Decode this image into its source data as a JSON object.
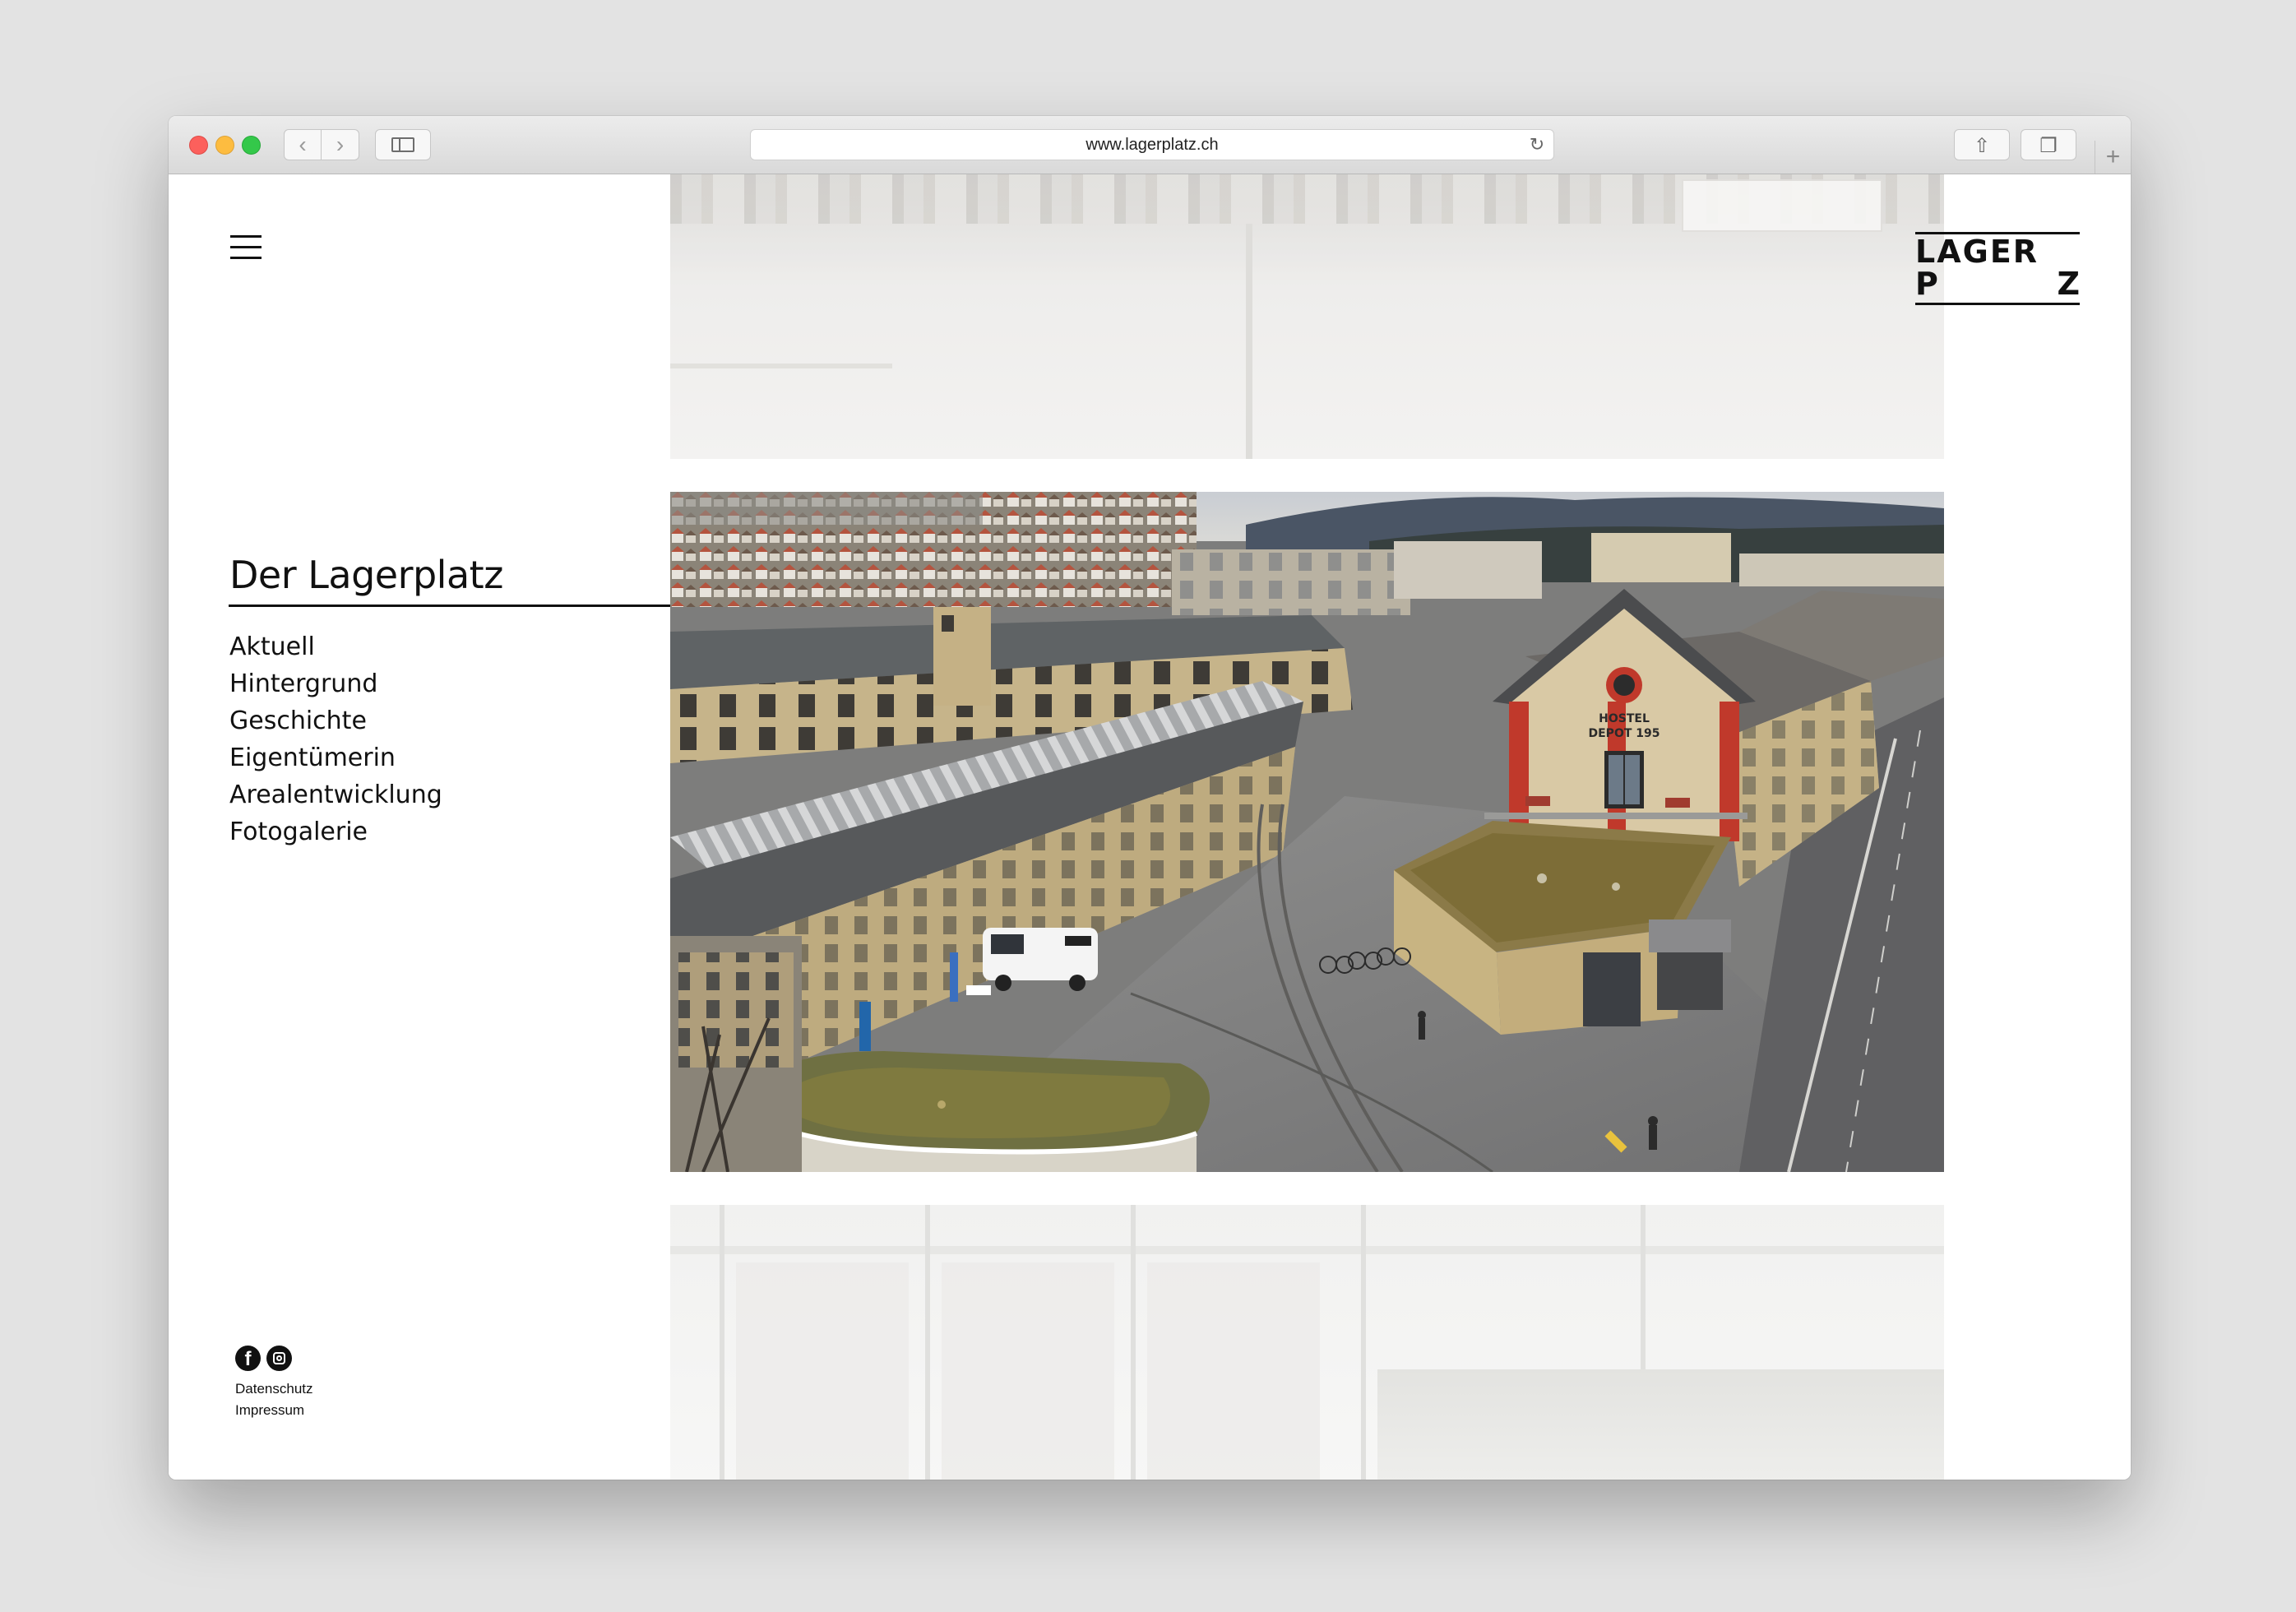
{
  "browser": {
    "url": "www.lagerplatz.ch",
    "buttons": {
      "back_glyph": "‹",
      "forward_glyph": "›",
      "reload_glyph": "↻",
      "share_glyph": "⇧",
      "tabs_glyph": "❐",
      "new_tab_glyph": "+"
    }
  },
  "logo": {
    "line1": "LAGER",
    "line2_left": "P",
    "line2_right": "Z"
  },
  "section": {
    "title": "Der Lagerplatz"
  },
  "menu": {
    "items": [
      {
        "label": "Aktuell"
      },
      {
        "label": "Hintergrund"
      },
      {
        "label": "Geschichte"
      },
      {
        "label": "Eigentümerin"
      },
      {
        "label": "Arealentwicklung"
      },
      {
        "label": "Fotogalerie"
      }
    ]
  },
  "social": {
    "facebook_glyph": "f",
    "icons": [
      "facebook-icon",
      "instagram-icon"
    ]
  },
  "footer": {
    "privacy": "Datenschutz",
    "imprint": "Impressum"
  },
  "photo_signs": {
    "hostel_line1": "HOSTEL",
    "hostel_line2": "DEPOT 195"
  },
  "colors": {
    "text": "#111111",
    "background": "#ffffff",
    "chrome": "#e1e1e1"
  }
}
